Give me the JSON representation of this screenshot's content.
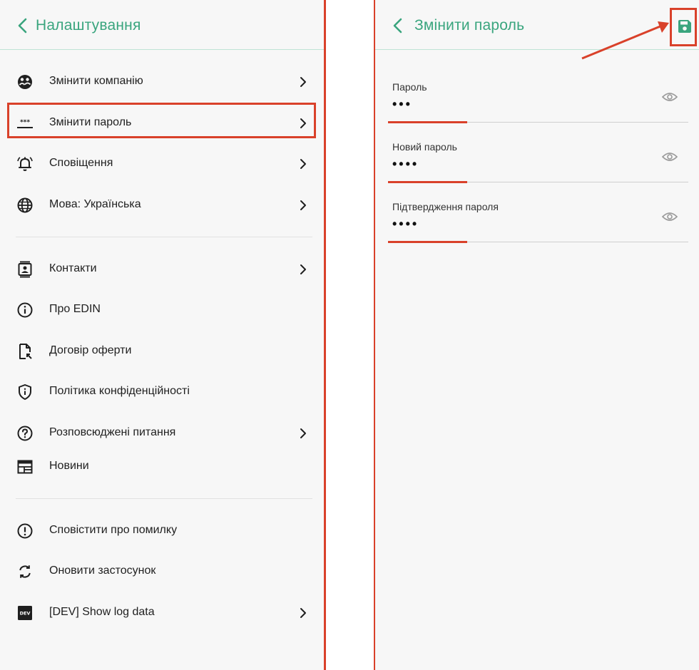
{
  "left": {
    "header": {
      "title": "Налаштування"
    },
    "menu": [
      {
        "label": "Змінити компанію",
        "icon": "company-icon",
        "chevron": true
      },
      {
        "label": "Змінити пароль",
        "icon": "password-icon",
        "chevron": true
      },
      {
        "label": "Сповіщення",
        "icon": "bell-icon",
        "chevron": true
      },
      {
        "label": "Мова: Українська",
        "icon": "globe-icon",
        "chevron": true
      },
      {
        "label": "Контакти",
        "icon": "contacts-icon",
        "chevron": true
      },
      {
        "label": "Про EDIN",
        "icon": "info-icon",
        "chevron": false
      },
      {
        "label": "Договір оферти",
        "icon": "document-icon",
        "chevron": false
      },
      {
        "label": "Політика конфіденційності",
        "icon": "shield-icon",
        "chevron": false
      },
      {
        "label": "Розповсюджені питання",
        "icon": "help-icon",
        "chevron": true
      },
      {
        "label": "Новини",
        "icon": "news-icon",
        "chevron": false
      },
      {
        "label": "Сповістити про помилку",
        "icon": "alert-icon",
        "chevron": false
      },
      {
        "label": "Оновити застосунок",
        "icon": "refresh-icon",
        "chevron": false
      },
      {
        "label": "[DEV] Show log data",
        "icon": "dev-icon",
        "chevron": true
      }
    ],
    "dev_icon_text": "DEV",
    "password_icon_text": "***"
  },
  "right": {
    "header": {
      "title": "Змінити пароль"
    },
    "fields": [
      {
        "label": "Пароль",
        "value": "•••"
      },
      {
        "label": "Новий пароль",
        "value": "••••"
      },
      {
        "label": "Підтвердження пароля",
        "value": "••••"
      }
    ]
  },
  "colors": {
    "accent": "#3aa57e",
    "annotation": "#d9412a",
    "background": "#f7f7f7",
    "text": "#1f1f1f"
  }
}
